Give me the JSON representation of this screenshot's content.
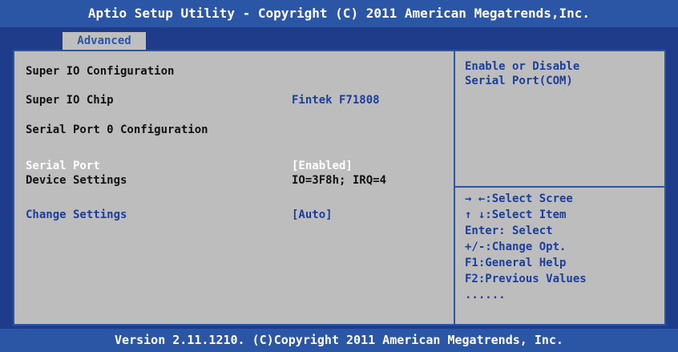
{
  "header": {
    "title": "Aptio Setup Utility - Copyright (C) 2011 American Megatrends,Inc."
  },
  "tabs": [
    {
      "label": "Advanced",
      "active": true
    }
  ],
  "settings": {
    "heading": "Super IO Configuration",
    "chip": {
      "label": "Super IO Chip",
      "value": "Fintek F71808"
    },
    "section": "Serial Port 0 Configuration",
    "serial_port": {
      "label": "Serial Port",
      "value": "[Enabled]"
    },
    "device_settings": {
      "label": "Device Settings",
      "value": "IO=3F8h; IRQ=4"
    },
    "change_settings": {
      "label": "Change Settings",
      "value": "[Auto]"
    }
  },
  "help": {
    "text_line1": "Enable or Disable",
    "text_line2": "Serial Port(COM)"
  },
  "keys": [
    "→ ←:Select Scree",
    "↑ ↓:Select Item",
    "Enter: Select",
    "+/-:Change Opt.",
    "F1:General Help",
    "F2:Previous Values",
    "......"
  ],
  "footer": {
    "version": "Version 2.11.1210. (C)Copyright 2011 American Megatrends, Inc."
  },
  "colors": {
    "background": "#1f3c8a",
    "bar": "#2b56a6",
    "panel": "#bdbdbd",
    "highlight": "#ffffff",
    "accent_text": "#1c3f9c"
  }
}
